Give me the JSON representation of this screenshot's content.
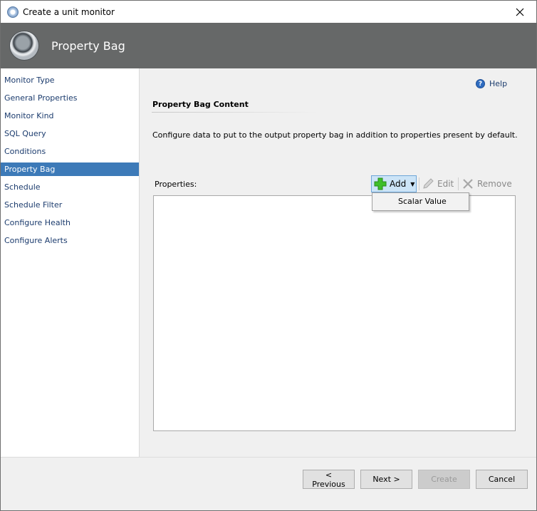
{
  "window": {
    "title": "Create a unit monitor",
    "header_title": "Property Bag"
  },
  "nav": {
    "items": [
      {
        "label": "Monitor Type"
      },
      {
        "label": "General Properties"
      },
      {
        "label": "Monitor Kind"
      },
      {
        "label": "SQL Query"
      },
      {
        "label": "Conditions"
      },
      {
        "label": "Property Bag",
        "active": true
      },
      {
        "label": "Schedule"
      },
      {
        "label": "Schedule Filter"
      },
      {
        "label": "Configure Health"
      },
      {
        "label": "Configure Alerts"
      }
    ]
  },
  "content": {
    "help_label": "Help",
    "section_title": "Property Bag Content",
    "description": "Configure data to put to the output property bag in addition to properties present by default.",
    "properties_label": "Properties:",
    "toolbar": {
      "add_label": "Add",
      "edit_label": "Edit",
      "remove_label": "Remove"
    },
    "add_menu": {
      "items": [
        "Scalar Value"
      ]
    }
  },
  "footer": {
    "previous_label": "< Previous",
    "next_label": "Next >",
    "create_label": "Create",
    "cancel_label": "Cancel"
  },
  "colors": {
    "header_band": "#666868",
    "nav_active": "#3d7ab8",
    "link_text": "#1c3c6e"
  }
}
